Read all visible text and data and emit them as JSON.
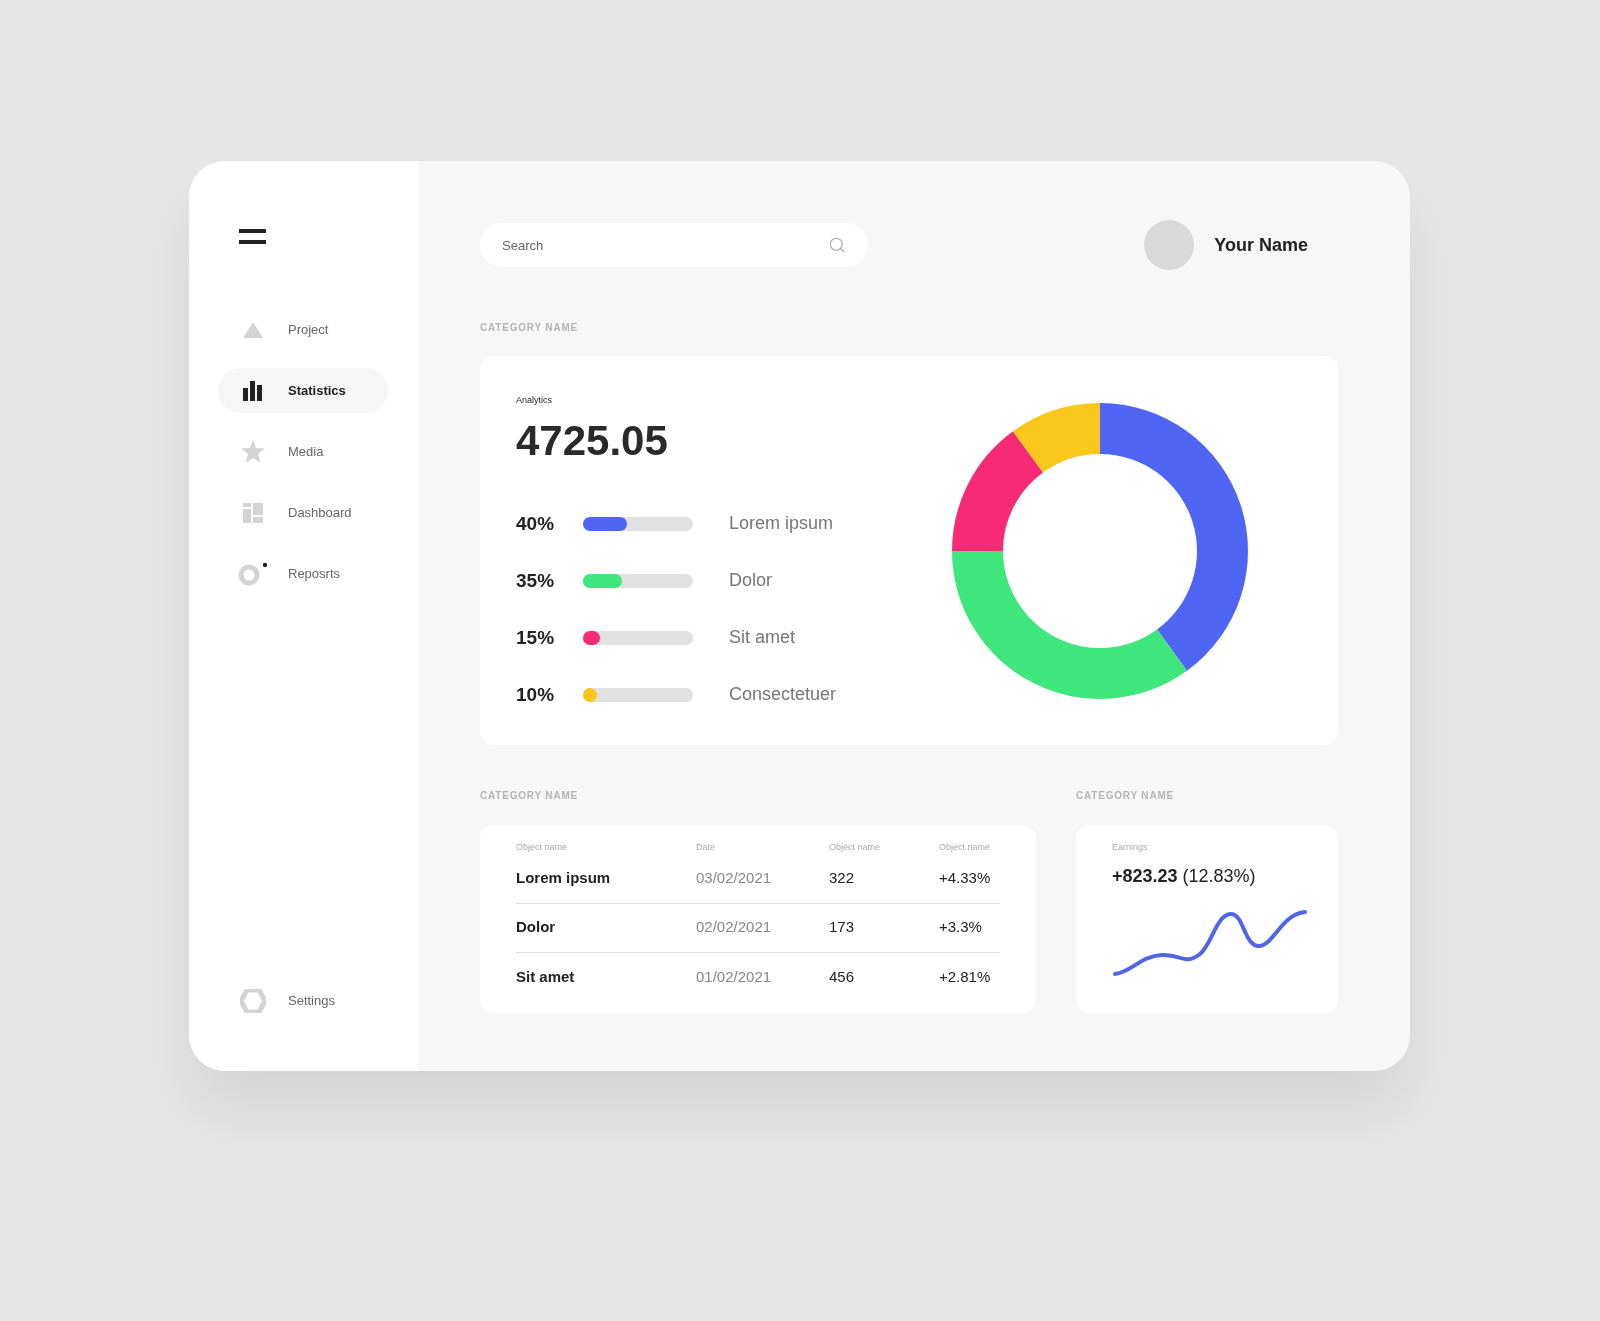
{
  "sidebar": {
    "items": [
      {
        "label": "Project",
        "kind": "triangle",
        "selected": false
      },
      {
        "label": "Statistics",
        "kind": "bars",
        "selected": true
      },
      {
        "label": "Media",
        "kind": "star",
        "selected": false
      },
      {
        "label": "Dashboard",
        "kind": "tiles",
        "selected": false
      },
      {
        "label": "Reposrts",
        "kind": "ring",
        "selected": false
      }
    ],
    "footer": {
      "label": "Settings",
      "kind": "hexagon"
    }
  },
  "search": {
    "placeholder": "Search"
  },
  "user": {
    "name": "Your Name"
  },
  "analytics_section": {
    "heading": "CATEGORY NAME",
    "card": {
      "title": "Analytics",
      "total": "4725.05",
      "breakdown": [
        {
          "percent": "40%",
          "level": 0.4,
          "color": "#4f66f5"
        },
        {
          "percent": "35%",
          "level": 0.35,
          "color": "#3fe67b"
        },
        {
          "percent": "15%",
          "level": 0.15,
          "color": "#f72a76"
        },
        {
          "percent": "10%",
          "level": 0.12,
          "color": "#fcc71c"
        }
      ],
      "chart_data": {
        "type": "donut",
        "categories": [
          "Lorem ipsum",
          "Dolor",
          "Sit amet",
          "Consectetuer"
        ],
        "values": [
          40,
          35,
          15,
          10
        ]
      }
    }
  },
  "table_section": {
    "heading": "CATEGORY NAME",
    "columns": [
      "Object name",
      "Date",
      "Object name",
      "Object name"
    ],
    "rows": [
      [
        "Lorem ipsum",
        "03/02/2021",
        "322",
        "+4.33%"
      ],
      [
        "Dolor",
        "02/02/2021",
        "173",
        "+3.3%"
      ],
      [
        "Sit amet",
        "01/02/2021",
        "456",
        "+2.81%"
      ]
    ]
  },
  "earnings_section": {
    "heading": "CATEGORY NAME",
    "label": "Earnings",
    "value": "+823.23",
    "change": "(12.83%)"
  }
}
